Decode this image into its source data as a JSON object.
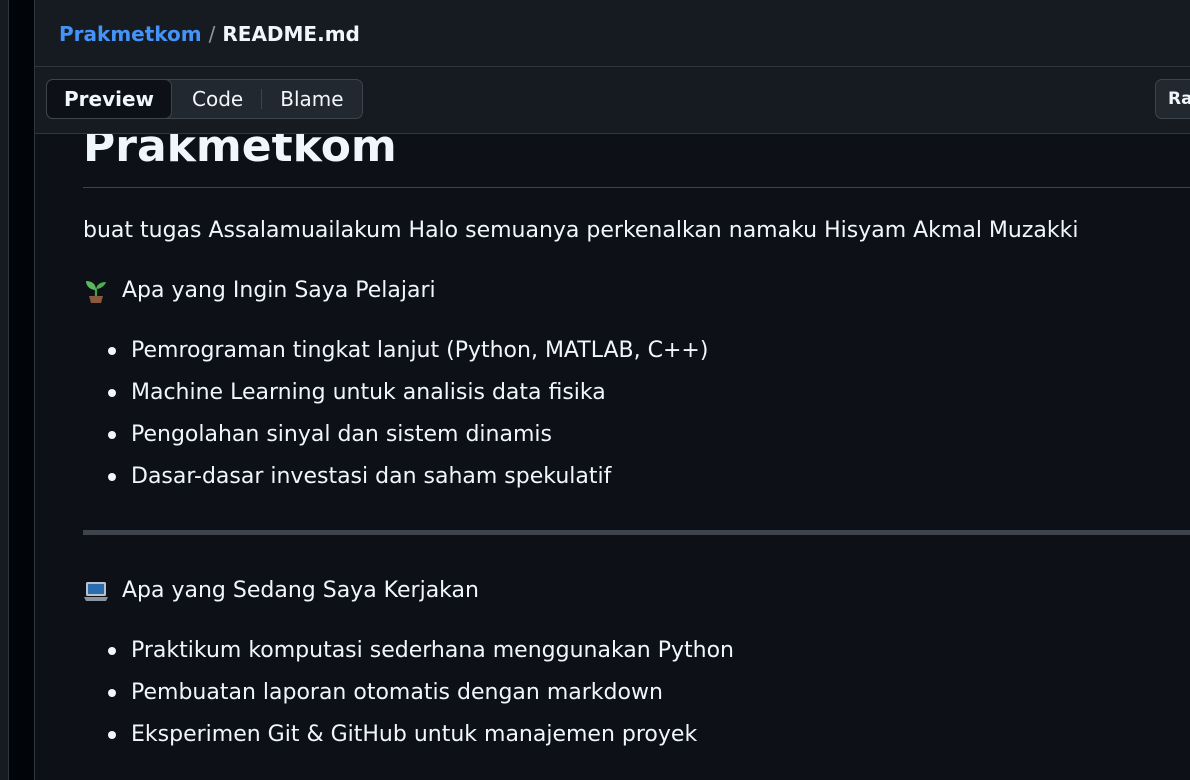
{
  "breadcrumb": {
    "repo": "Prakmetkom",
    "separator": "/",
    "file": "README.md"
  },
  "toolbar": {
    "tabs": [
      {
        "label": "Preview",
        "active": true
      },
      {
        "label": "Code",
        "active": false
      },
      {
        "label": "Blame",
        "active": false
      }
    ],
    "raw_label": "Raw"
  },
  "readme": {
    "title": "Prakmetkom",
    "intro": "buat tugas Assalamuailakum Halo semuanya perkenalkan namaku Hisyam Akmal Muzakki",
    "section1": {
      "icon": "seedling-icon",
      "heading": "Apa yang Ingin Saya Pelajari",
      "items": [
        "Pemrograman tingkat lanjut (Python, MATLAB, C++)",
        "Machine Learning untuk analisis data fisika",
        "Pengolahan sinyal dan sistem dinamis",
        "Dasar-dasar investasi dan saham spekulatif"
      ]
    },
    "section2": {
      "icon": "laptop-icon",
      "heading": "Apa yang Sedang Saya Kerjakan",
      "items": [
        "Praktikum komputasi sederhana menggunakan Python",
        "Pembuatan laporan otomatis dengan markdown",
        "Eksperimen Git & GitHub untuk manajemen proyek"
      ]
    }
  },
  "colors": {
    "background": "#0d1117",
    "header": "#161b22",
    "link": "#4493f8",
    "text": "#f0f6fc",
    "border": "#3d444d"
  }
}
